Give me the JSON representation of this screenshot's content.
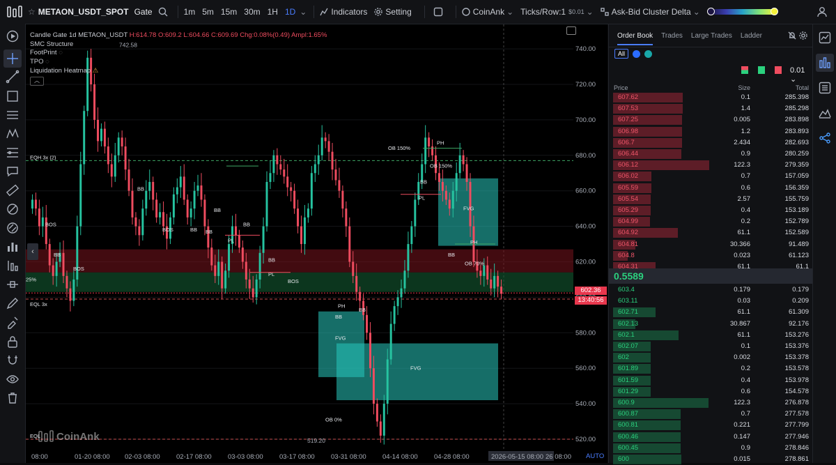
{
  "topbar": {
    "symbol": "METAON_USDT_SPOT",
    "exchange": "Gate",
    "timeframes": [
      "1m",
      "5m",
      "15m",
      "30m",
      "1H",
      "1D"
    ],
    "active_timeframe": "1D",
    "indicators_label": "Indicators",
    "setting_label": "Setting",
    "source_label": "CoinAnk",
    "ticks_label": "Ticks/Row:1",
    "tick_size": "$0.01",
    "cluster_label": "Ask-Bid Cluster Delta"
  },
  "legend": {
    "line1_prefix": "Candle",
    "line1_symbol": "Gate 1d METAON_USDT",
    "ohlc": "H:614.78  O:609.2  L:604.66  C:609.69",
    "change": "Chg:0.08%(0.49)",
    "ampl": "Ampl:1.65%",
    "indicators": [
      "SMC Structure",
      "FootPrint",
      "TPO",
      "Liquidation Heatmap"
    ]
  },
  "chart_data": {
    "type": "candlestick",
    "y_ticks": [
      "740.00",
      "720.00",
      "700.00",
      "680.00",
      "660.00",
      "640.00",
      "620.00",
      "600.00",
      "580.00",
      "560.00",
      "540.00",
      "520.00"
    ],
    "x_ticks": [
      "08:00",
      "01-20 08:00",
      "02-03 08:00",
      "02-17 08:00",
      "03-03 08:00",
      "03-17 08:00",
      "03-31 08:00",
      "04-14 08:00",
      "04-28 08:00",
      "2026-05-15 08:00",
      "26 08:00"
    ],
    "last_price": "602.36",
    "countdown": "13:40:56",
    "high_label": "742.58",
    "low_label": "519.20",
    "auto_label": "AUTO",
    "watermark": "CoinAnk",
    "annotations": {
      "eqh": "EQH 3x (2)",
      "eql": "EQL 3x",
      "eql_bottom": "EQL",
      "fvg": "FVG",
      "ph": "PH",
      "pl": "PL",
      "bos": "BOS",
      "bb": "BB",
      "ob150": "OB 150%",
      "ob70": "OB 70%",
      "ob0": "OB 0%",
      "pct25": "25%"
    }
  },
  "orderbook": {
    "tabs": [
      "Order Book",
      "Trades",
      "Large Trades",
      "Ladder"
    ],
    "filter_all": "All",
    "precision": "0.01",
    "columns": [
      "Price",
      "Size",
      "Total"
    ],
    "mid_price": "0.5589",
    "asks": [
      [
        "607.62",
        "0.1",
        "285.398"
      ],
      [
        "607.53",
        "1.4",
        "285.298"
      ],
      [
        "607.25",
        "0.005",
        "283.898"
      ],
      [
        "606.98",
        "1.2",
        "283.893"
      ],
      [
        "606.7",
        "2.434",
        "282.693"
      ],
      [
        "606.44",
        "0.9",
        "280.259"
      ],
      [
        "606.12",
        "122.3",
        "279.359"
      ],
      [
        "606.02",
        "0.7",
        "157.059"
      ],
      [
        "605.59",
        "0.6",
        "156.359"
      ],
      [
        "605.54",
        "2.57",
        "155.759"
      ],
      [
        "605.29",
        "0.4",
        "153.189"
      ],
      [
        "604.99",
        "0.2",
        "152.789"
      ],
      [
        "604.92",
        "61.1",
        "152.589"
      ],
      [
        "604.81",
        "30.366",
        "91.489"
      ],
      [
        "604.8",
        "0.023",
        "61.123"
      ],
      [
        "604.31",
        "61.1",
        "61.1"
      ]
    ],
    "bids": [
      [
        "603.4",
        "0.179",
        "0.179"
      ],
      [
        "603.11",
        "0.03",
        "0.209"
      ],
      [
        "602.71",
        "61.1",
        "61.309"
      ],
      [
        "602.13",
        "30.867",
        "92.176"
      ],
      [
        "602.1",
        "61.1",
        "153.276"
      ],
      [
        "602.07",
        "0.1",
        "153.376"
      ],
      [
        "602",
        "0.002",
        "153.378"
      ],
      [
        "601.89",
        "0.2",
        "153.578"
      ],
      [
        "601.59",
        "0.4",
        "153.978"
      ],
      [
        "601.29",
        "0.6",
        "154.578"
      ],
      [
        "600.9",
        "122.3",
        "276.878"
      ],
      [
        "600.87",
        "0.7",
        "277.578"
      ],
      [
        "600.81",
        "0.221",
        "277.799"
      ],
      [
        "600.46",
        "0.147",
        "277.946"
      ],
      [
        "600.45",
        "0.9",
        "278.846"
      ],
      [
        "600",
        "0.015",
        "278.861"
      ]
    ]
  },
  "colors": {
    "up": "#26c3a0",
    "down": "#ef4c5f",
    "accent": "#4a7dff",
    "ask": "#f0566a",
    "bid": "#2bd17e"
  }
}
